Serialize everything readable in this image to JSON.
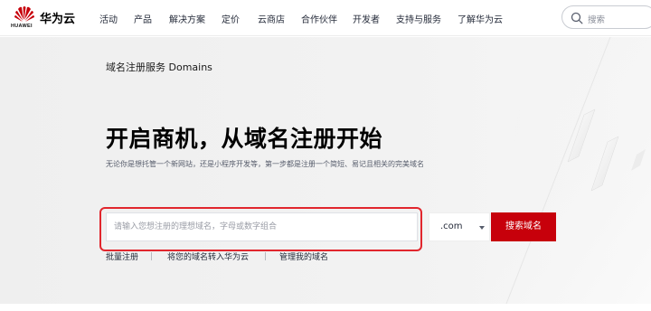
{
  "brand": {
    "logo_text": "HUAWEI",
    "name": "华为云",
    "accent_color": "#c7000b"
  },
  "nav": {
    "items": [
      "活动",
      "产品",
      "解决方案",
      "定价",
      "云商店",
      "合作伙伴",
      "开发者",
      "支持与服务",
      "了解华为云"
    ]
  },
  "search": {
    "placeholder": "搜索",
    "icon": "search-icon"
  },
  "hero": {
    "breadcrumb": "域名注册服务 Domains",
    "title": "开启商机，从域名注册开始",
    "subtitle": "无论你是想托管一个新网站，还是小程序开发等，第一步都是注册一个简短、易记且相关的完美域名",
    "input_placeholder": "请输入您想注册的理想域名，字母或数字组合",
    "suffix": ".com",
    "search_button": "搜索域名",
    "links": [
      "批量注册",
      "将您的域名转入华为云",
      "管理我的域名"
    ]
  }
}
